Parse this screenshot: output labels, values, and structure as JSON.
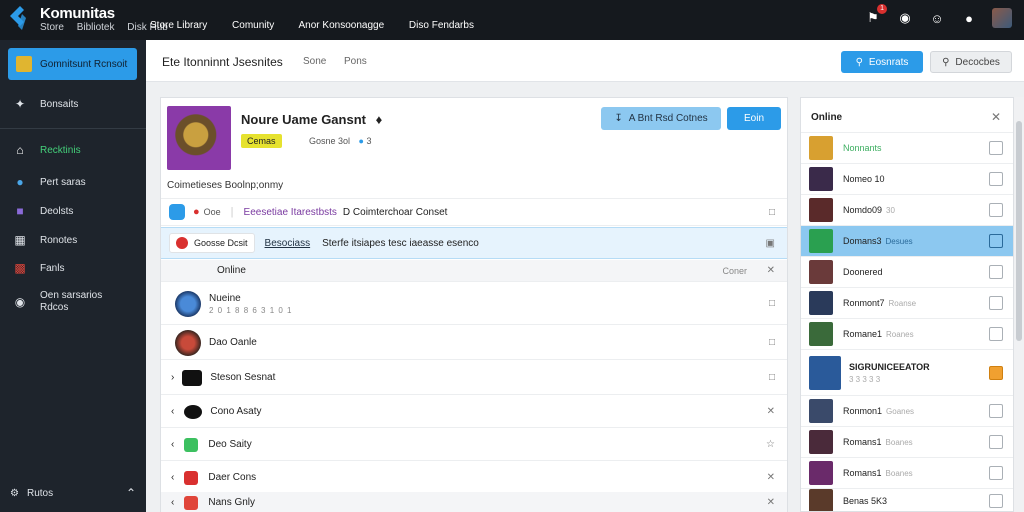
{
  "topbar": {
    "brand": "Komunitas",
    "subnav": [
      "Store",
      "Bibliotek",
      "Disk Hub"
    ],
    "nav": [
      "Store Library",
      "Comunity",
      "Anor Konsoonagge",
      "Diso Fendarbs"
    ],
    "notif_count": "1"
  },
  "sidebar": {
    "primary": "Gomnitsunt Rcnsoit",
    "items": [
      {
        "label": "Bonsaits",
        "icon": "puzzle-icon"
      },
      {
        "label": "Recktinis",
        "icon": "home-icon"
      },
      {
        "label": "Pert saras",
        "icon": "drop-icon"
      },
      {
        "label": "Deolsts",
        "icon": "game-icon"
      },
      {
        "label": "Ronotes",
        "icon": "grid-icon"
      },
      {
        "label": "Fanls",
        "icon": "tile-icon"
      },
      {
        "label": "Oen sarsarios\nRdcos",
        "icon": "chat-icon"
      }
    ],
    "bottom": "Rutos"
  },
  "header": {
    "title": "Ete Itonninnt Jsesnites",
    "tabs": [
      "Sone",
      "Pons"
    ],
    "btn_primary": "Eosnrats",
    "btn_secondary": "Decocbes"
  },
  "game": {
    "title": "Noure Uame Gansnt",
    "tag": "Cemas",
    "meta": "Gosne 3ol",
    "meta_num": "3",
    "btn_light": "A Bnt Rsd Cotnes",
    "btn_primary": "Eoin",
    "section": "Coimetieses Boolnp;onmy"
  },
  "rows": [
    {
      "a": "Ooe",
      "b": "Eeesetiae Itarestbsts",
      "c": "D Coimterchoar Conset"
    },
    {
      "a": "Goosse Dcsit",
      "b": "Besociass",
      "c": "Sterfe itsiapes tesc iaeasse esenco"
    }
  ],
  "online_header": {
    "label": "Online",
    "right": "Coner"
  },
  "players": [
    {
      "name": "Nueine",
      "sub": "2 0 1 8 8 6 3 1 0 1"
    },
    {
      "name": "Dao Oanle",
      "sub": ""
    },
    {
      "name": "Steson Sesnat",
      "sub": ""
    },
    {
      "name": "Cono Asaty",
      "sub": ""
    },
    {
      "name": "Deo Saity",
      "sub": ""
    },
    {
      "name": "Daer Cons",
      "sub": ""
    },
    {
      "name": "Nans Gnly",
      "sub": ""
    }
  ],
  "rpanel": {
    "title": "Online",
    "items": [
      {
        "name": "Nonnants",
        "sub": "",
        "green": true
      },
      {
        "name": "Nomeo 10",
        "sub": ""
      },
      {
        "name": "Nomdo09",
        "sub": "30"
      },
      {
        "name": "Domans3",
        "sub": "Desues"
      },
      {
        "name": "Doonered",
        "sub": ""
      },
      {
        "name": "Ronmont7",
        "sub": "Roanse"
      },
      {
        "name": "Romane1",
        "sub": "Roanes"
      },
      {
        "name": "SIGRUNICEEATOR",
        "sub": "3 3 3 3 3"
      },
      {
        "name": "Ronmon1",
        "sub": "Goanes"
      },
      {
        "name": "Romans1",
        "sub": "Boanes"
      },
      {
        "name": "Romans1",
        "sub": "Boanes"
      },
      {
        "name": "Benas 5K3",
        "sub": ""
      }
    ]
  },
  "colors": {
    "accent": "#2c9be8",
    "topbar": "#15191e",
    "sidebar": "#1e242c",
    "online": "#44d07a"
  }
}
